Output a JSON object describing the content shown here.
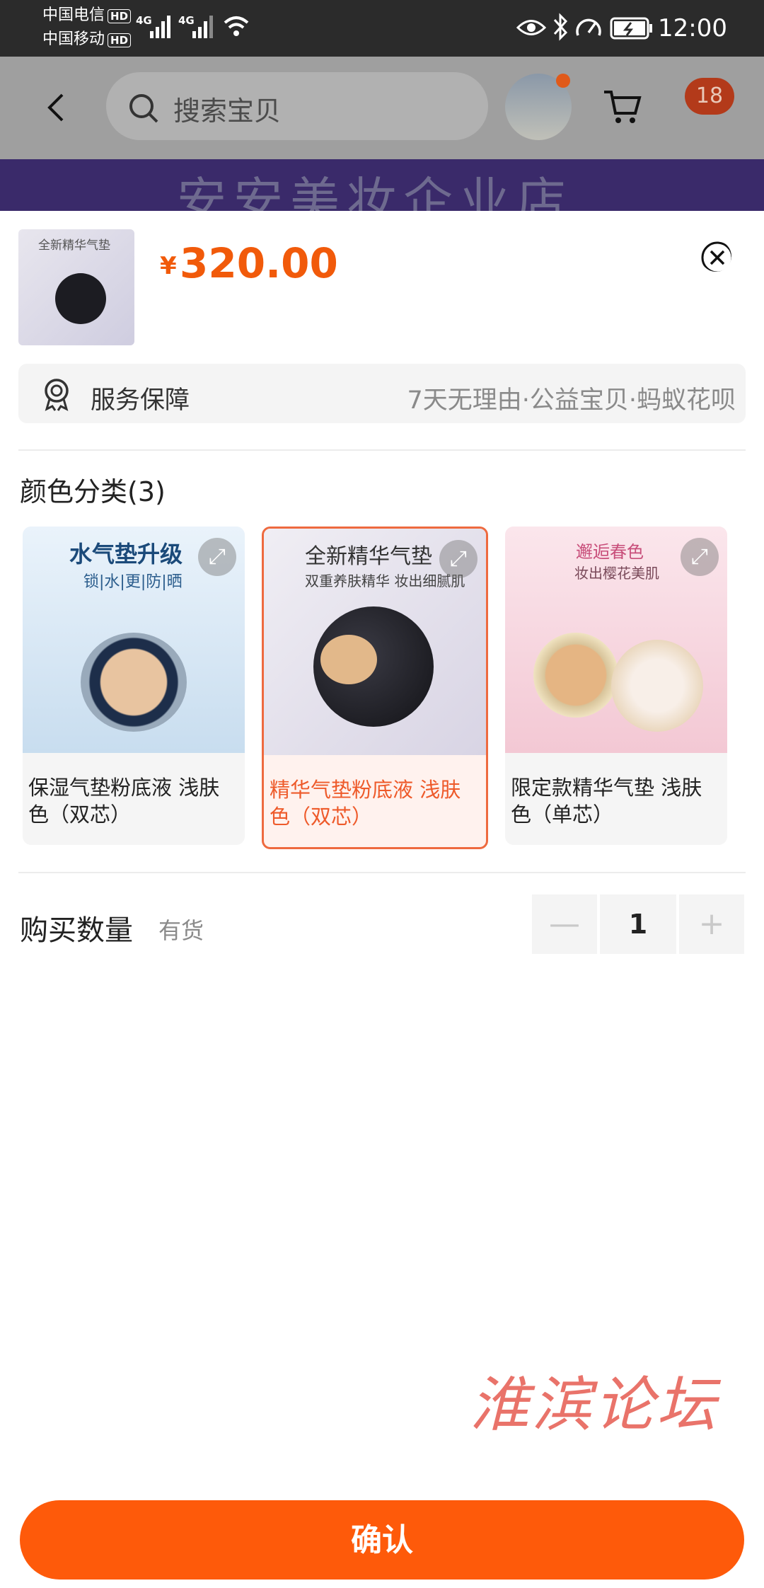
{
  "status_bar": {
    "carrier1": "中国电信",
    "carrier2": "中国移动",
    "hd": "HD",
    "net": "4G",
    "time": "12:00"
  },
  "header": {
    "search_placeholder": "搜索宝贝",
    "cart_badge": "18",
    "banner_text": "安安美妆企业店"
  },
  "product": {
    "price_symbol": "¥",
    "price": "320.00",
    "thumb_text": "全新精华气垫"
  },
  "service": {
    "label": "服务保障",
    "value": "7天无理由·公益宝贝·蚂蚁花呗"
  },
  "color_section": {
    "title": "颜色分类(3)",
    "options": [
      {
        "label": "保湿气垫粉底液 浅肤色（双芯）",
        "img_title": "水气垫升级",
        "img_sub": "锁|水|更|防|晒",
        "selected": false
      },
      {
        "label": "精华气垫粉底液  浅肤色（双芯）",
        "img_title": "全新精华气垫",
        "img_sub": "双重养肤精华 妆出细腻肌",
        "selected": true
      },
      {
        "label": "限定款精华气垫  浅肤色（单芯）",
        "img_title": "邂逅春色",
        "img_sub": "妆出樱花美肌",
        "selected": false
      }
    ]
  },
  "quantity": {
    "label": "购买数量",
    "stock": "有货",
    "value": "1",
    "minus": "—",
    "plus": "+"
  },
  "watermark": "淮滨论坛",
  "confirm_label": "确认"
}
